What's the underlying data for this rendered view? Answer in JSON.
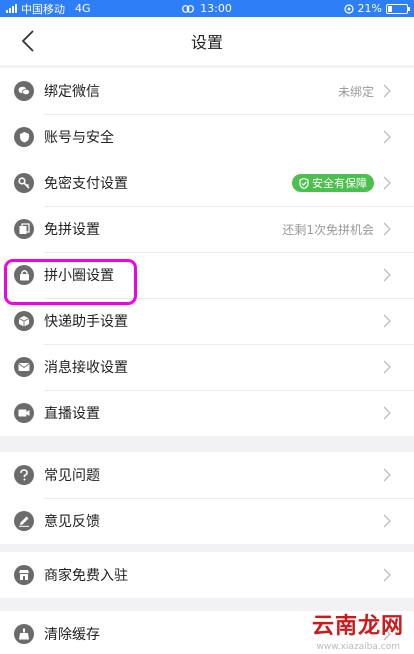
{
  "status_bar": {
    "carrier": "中国移动",
    "network": "4G",
    "time": "13:00",
    "battery_percent": "21%",
    "battery_level": 0.21
  },
  "nav": {
    "title": "设置"
  },
  "groups": [
    [
      {
        "label": "绑定微信",
        "value": "未绑定",
        "icon": "wechat-icon"
      },
      {
        "label": "账号与安全",
        "value": "",
        "icon": "shield-icon"
      }
    ],
    [
      {
        "label": "免密支付设置",
        "badge": "安全有保障",
        "icon": "key-icon"
      },
      {
        "label": "免拼设置",
        "value": "还剩1次免拼机会",
        "icon": "copy-icon"
      },
      {
        "label": "拼小圈设置",
        "value": "",
        "icon": "lock-icon"
      },
      {
        "label": "快递助手设置",
        "value": "",
        "icon": "package-icon"
      },
      {
        "label": "消息接收设置",
        "value": "",
        "icon": "mail-icon"
      },
      {
        "label": "直播设置",
        "value": "",
        "icon": "video-icon"
      }
    ],
    [
      {
        "label": "常见问题",
        "value": "",
        "icon": "question-icon"
      },
      {
        "label": "意见反馈",
        "value": "",
        "icon": "edit-icon"
      }
    ],
    [
      {
        "label": "商家免费入驻",
        "value": "",
        "icon": "store-icon"
      }
    ],
    [
      {
        "label": "清除缓存",
        "value": "",
        "icon": "broom-icon"
      }
    ]
  ],
  "watermark": {
    "text": "云南龙网",
    "url_text": "www.xiazaiba.com"
  },
  "colors": {
    "status_bar": "#2d7ef7",
    "badge": "#4cbf4e",
    "highlight": "#f000ea",
    "icon": "#6b6b6b"
  }
}
